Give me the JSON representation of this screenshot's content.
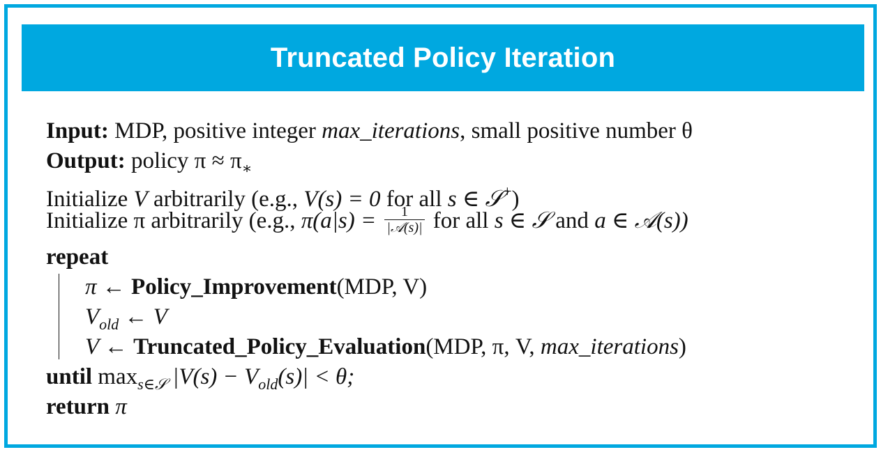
{
  "header": {
    "title": "Truncated Policy Iteration"
  },
  "algorithm": {
    "input_keyword": "Input:",
    "input_text_1": "MDP, positive integer",
    "input_var": "max_iterations",
    "input_text_2": ", small positive number θ",
    "output_keyword": "Output:",
    "output_text": "policy π ≈ π",
    "output_sub": "∗",
    "init_v_1": "Initialize",
    "init_v_var": "V",
    "init_v_2": "arbitrarily (e.g.,",
    "init_v_expr": "V(s) = 0",
    "init_v_3": "for all",
    "init_v_expr2": "s ∈ 𝒮",
    "init_v_sup": "+",
    "init_v_close": ")",
    "init_pi_1": "Initialize π arbitrarily (e.g.,",
    "init_pi_expr": "π(a|s) =",
    "init_pi_frac_num": "1",
    "init_pi_frac_den": "|𝒜(s)|",
    "init_pi_2": "for all",
    "init_pi_expr2": "s ∈ 𝒮",
    "init_pi_3": "and",
    "init_pi_expr3": "a ∈ 𝒜(s))",
    "repeat_keyword": "repeat",
    "step1_lhs": "π ←",
    "step1_fn": "Policy_Improvement",
    "step1_args": "(MDP, V)",
    "step2_lhs": "V",
    "step2_sub": "old",
    "step2_rhs": "← V",
    "step3_lhs": "V ←",
    "step3_fn": "Truncated_Policy_Evaluation",
    "step3_args_1": "(MDP, π, V,",
    "step3_args_var": "max_iterations",
    "step3_args_2": ")",
    "until_keyword": "until",
    "until_max": "max",
    "until_sub": "s∈𝒮",
    "until_expr_1": "|V(s) − V",
    "until_expr_sub": "old",
    "until_expr_2": "(s)| < θ;",
    "return_keyword": "return",
    "return_value": "π"
  }
}
